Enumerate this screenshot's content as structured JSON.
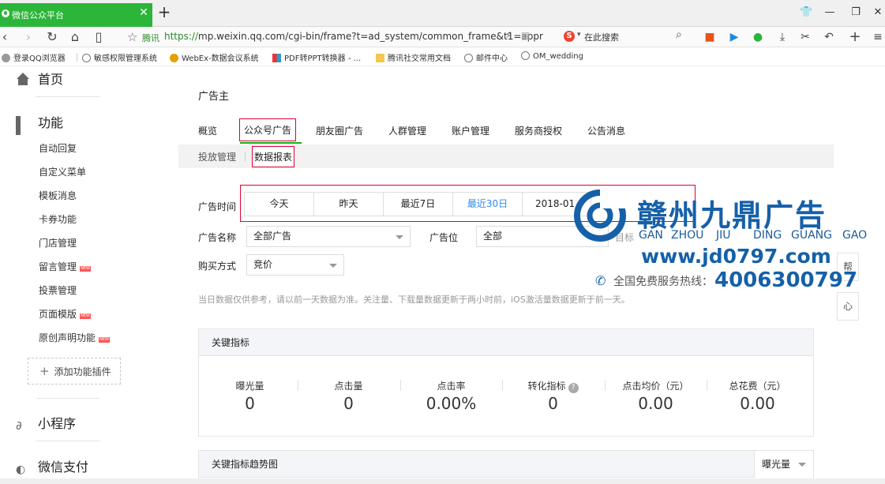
{
  "browser": {
    "tab_title": "微信公众平台",
    "tab_close": "✕",
    "new_tab": "+",
    "site_name": "腾讯",
    "url_scheme": "https://",
    "url_rest": "mp.weixin.qq.com/cgi-bin/frame?t=ad_system/common_frame&t1=appr",
    "search_placeholder": "在此搜索",
    "bookmarks": [
      "登录QQ浏览器",
      "敏感权限管理系统",
      "WebEx-数据会议系统",
      "PDF转PPT转换器 - ...",
      "腾讯社交常用文档",
      "邮件中心",
      "OM_wedding"
    ]
  },
  "sidebar": {
    "home": "首页",
    "features": "功能",
    "items": [
      {
        "label": "自动回复",
        "new": false
      },
      {
        "label": "自定义菜单",
        "new": false
      },
      {
        "label": "模板消息",
        "new": false
      },
      {
        "label": "卡券功能",
        "new": false
      },
      {
        "label": "门店管理",
        "new": false
      },
      {
        "label": "留言管理",
        "new": true
      },
      {
        "label": "投票管理",
        "new": false
      },
      {
        "label": "页面模版",
        "new": true
      },
      {
        "label": "原创声明功能",
        "new": true
      }
    ],
    "new_badge": "NEW",
    "add_plugin": "添加功能插件",
    "mini_program": "小程序",
    "wechat_pay": "微信支付"
  },
  "main": {
    "title": "广告主",
    "tabs": [
      "概览",
      "公众号广告",
      "朋友圈广告",
      "人群管理",
      "账户管理",
      "服务商授权",
      "公告消息"
    ],
    "subtabs": [
      "投放管理",
      "数据报表"
    ],
    "ad_time_label": "广告时间",
    "date_options": [
      "今天",
      "昨天",
      "最近7日",
      "最近30日",
      "2018-01"
    ],
    "selected_date": "最近30日",
    "ad_name_label": "广告名称",
    "ad_name_value": "全部广告",
    "ad_slot_label": "广告位",
    "ad_slot_value": "全部",
    "goal_label": "目标",
    "buy_type_label": "购买方式",
    "buy_type_value": "竞价",
    "hint": "当日数据仅供参考，请以前一天数据为准。关注量、下载量数据更新于两小时前，iOS激活量数据更新于前一天。",
    "key_metrics_title": "关键指标",
    "metrics": [
      {
        "label": "曝光量",
        "value": "0",
        "help": false
      },
      {
        "label": "点击量",
        "value": "0",
        "help": false
      },
      {
        "label": "点击率",
        "value": "0.00%",
        "help": false
      },
      {
        "label": "转化指标",
        "value": "0",
        "help": true
      },
      {
        "label": "点击均价（元）",
        "value": "0.00",
        "help": false
      },
      {
        "label": "总花费（元）",
        "value": "0.00",
        "help": false
      }
    ],
    "trend_title": "关键指标趋势图",
    "trend_select": "曝光量",
    "float_1": "帮",
    "float_2": "心"
  },
  "watermark": {
    "name_cn": "赣州九鼎广告",
    "pinyin": [
      "GAN",
      "ZHOU",
      "JIU",
      "DING",
      "GUANG",
      "GAO"
    ],
    "website": "www.jd0797.com",
    "hotline_label": "全国免费服务热线：",
    "hotline": "4006300797"
  },
  "colors": {
    "brand_green": "#1aad19",
    "tab_green": "#2bb539",
    "highlight_red": "#dd0033",
    "link_blue": "#2d8cf0",
    "watermark_blue": "#1560a9"
  }
}
